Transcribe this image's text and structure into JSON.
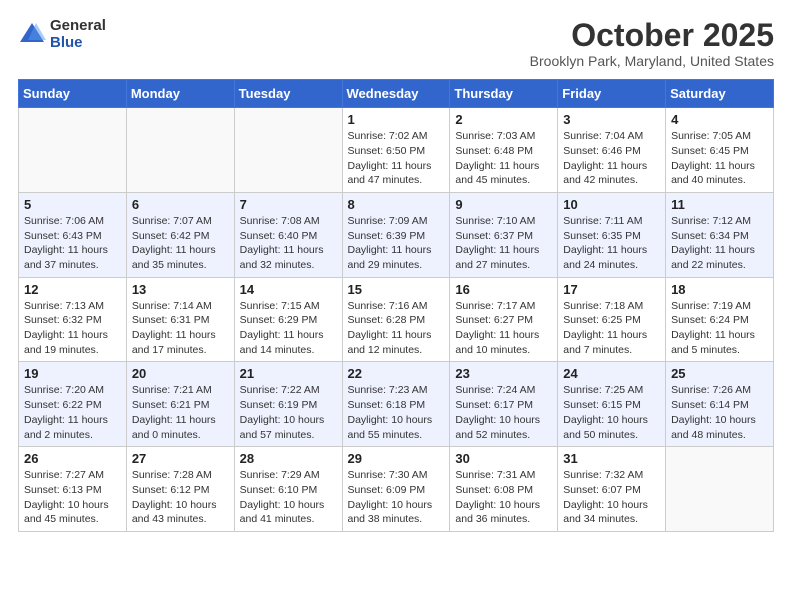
{
  "header": {
    "logo_general": "General",
    "logo_blue": "Blue",
    "month_title": "October 2025",
    "location": "Brooklyn Park, Maryland, United States"
  },
  "days_of_week": [
    "Sunday",
    "Monday",
    "Tuesday",
    "Wednesday",
    "Thursday",
    "Friday",
    "Saturday"
  ],
  "weeks": [
    [
      {
        "day": "",
        "info": ""
      },
      {
        "day": "",
        "info": ""
      },
      {
        "day": "",
        "info": ""
      },
      {
        "day": "1",
        "info": "Sunrise: 7:02 AM\nSunset: 6:50 PM\nDaylight: 11 hours and 47 minutes."
      },
      {
        "day": "2",
        "info": "Sunrise: 7:03 AM\nSunset: 6:48 PM\nDaylight: 11 hours and 45 minutes."
      },
      {
        "day": "3",
        "info": "Sunrise: 7:04 AM\nSunset: 6:46 PM\nDaylight: 11 hours and 42 minutes."
      },
      {
        "day": "4",
        "info": "Sunrise: 7:05 AM\nSunset: 6:45 PM\nDaylight: 11 hours and 40 minutes."
      }
    ],
    [
      {
        "day": "5",
        "info": "Sunrise: 7:06 AM\nSunset: 6:43 PM\nDaylight: 11 hours and 37 minutes."
      },
      {
        "day": "6",
        "info": "Sunrise: 7:07 AM\nSunset: 6:42 PM\nDaylight: 11 hours and 35 minutes."
      },
      {
        "day": "7",
        "info": "Sunrise: 7:08 AM\nSunset: 6:40 PM\nDaylight: 11 hours and 32 minutes."
      },
      {
        "day": "8",
        "info": "Sunrise: 7:09 AM\nSunset: 6:39 PM\nDaylight: 11 hours and 29 minutes."
      },
      {
        "day": "9",
        "info": "Sunrise: 7:10 AM\nSunset: 6:37 PM\nDaylight: 11 hours and 27 minutes."
      },
      {
        "day": "10",
        "info": "Sunrise: 7:11 AM\nSunset: 6:35 PM\nDaylight: 11 hours and 24 minutes."
      },
      {
        "day": "11",
        "info": "Sunrise: 7:12 AM\nSunset: 6:34 PM\nDaylight: 11 hours and 22 minutes."
      }
    ],
    [
      {
        "day": "12",
        "info": "Sunrise: 7:13 AM\nSunset: 6:32 PM\nDaylight: 11 hours and 19 minutes."
      },
      {
        "day": "13",
        "info": "Sunrise: 7:14 AM\nSunset: 6:31 PM\nDaylight: 11 hours and 17 minutes."
      },
      {
        "day": "14",
        "info": "Sunrise: 7:15 AM\nSunset: 6:29 PM\nDaylight: 11 hours and 14 minutes."
      },
      {
        "day": "15",
        "info": "Sunrise: 7:16 AM\nSunset: 6:28 PM\nDaylight: 11 hours and 12 minutes."
      },
      {
        "day": "16",
        "info": "Sunrise: 7:17 AM\nSunset: 6:27 PM\nDaylight: 11 hours and 10 minutes."
      },
      {
        "day": "17",
        "info": "Sunrise: 7:18 AM\nSunset: 6:25 PM\nDaylight: 11 hours and 7 minutes."
      },
      {
        "day": "18",
        "info": "Sunrise: 7:19 AM\nSunset: 6:24 PM\nDaylight: 11 hours and 5 minutes."
      }
    ],
    [
      {
        "day": "19",
        "info": "Sunrise: 7:20 AM\nSunset: 6:22 PM\nDaylight: 11 hours and 2 minutes."
      },
      {
        "day": "20",
        "info": "Sunrise: 7:21 AM\nSunset: 6:21 PM\nDaylight: 11 hours and 0 minutes."
      },
      {
        "day": "21",
        "info": "Sunrise: 7:22 AM\nSunset: 6:19 PM\nDaylight: 10 hours and 57 minutes."
      },
      {
        "day": "22",
        "info": "Sunrise: 7:23 AM\nSunset: 6:18 PM\nDaylight: 10 hours and 55 minutes."
      },
      {
        "day": "23",
        "info": "Sunrise: 7:24 AM\nSunset: 6:17 PM\nDaylight: 10 hours and 52 minutes."
      },
      {
        "day": "24",
        "info": "Sunrise: 7:25 AM\nSunset: 6:15 PM\nDaylight: 10 hours and 50 minutes."
      },
      {
        "day": "25",
        "info": "Sunrise: 7:26 AM\nSunset: 6:14 PM\nDaylight: 10 hours and 48 minutes."
      }
    ],
    [
      {
        "day": "26",
        "info": "Sunrise: 7:27 AM\nSunset: 6:13 PM\nDaylight: 10 hours and 45 minutes."
      },
      {
        "day": "27",
        "info": "Sunrise: 7:28 AM\nSunset: 6:12 PM\nDaylight: 10 hours and 43 minutes."
      },
      {
        "day": "28",
        "info": "Sunrise: 7:29 AM\nSunset: 6:10 PM\nDaylight: 10 hours and 41 minutes."
      },
      {
        "day": "29",
        "info": "Sunrise: 7:30 AM\nSunset: 6:09 PM\nDaylight: 10 hours and 38 minutes."
      },
      {
        "day": "30",
        "info": "Sunrise: 7:31 AM\nSunset: 6:08 PM\nDaylight: 10 hours and 36 minutes."
      },
      {
        "day": "31",
        "info": "Sunrise: 7:32 AM\nSunset: 6:07 PM\nDaylight: 10 hours and 34 minutes."
      },
      {
        "day": "",
        "info": ""
      }
    ]
  ]
}
